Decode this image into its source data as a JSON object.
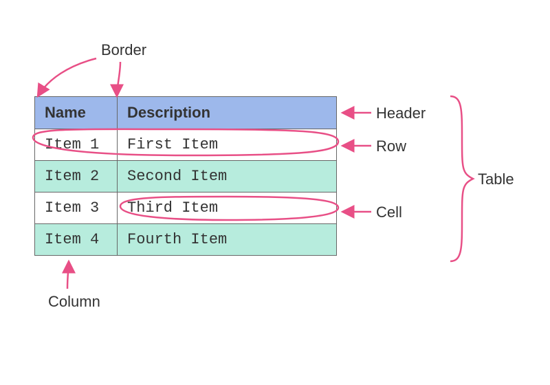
{
  "table": {
    "headers": {
      "name": "Name",
      "description": "Description"
    },
    "rows": [
      {
        "name": "Item 1",
        "description": "First Item"
      },
      {
        "name": "Item 2",
        "description": "Second Item"
      },
      {
        "name": "Item 3",
        "description": "Third Item"
      },
      {
        "name": "Item 4",
        "description": "Fourth Item"
      }
    ]
  },
  "annotations": {
    "border": "Border",
    "header": "Header",
    "row": "Row",
    "cell": "Cell",
    "table": "Table",
    "column": "Column"
  },
  "colors": {
    "header_bg": "#9db8eb",
    "stripe_bg": "#b7ecdd",
    "arrow": "#e84f86",
    "text": "#333333"
  }
}
